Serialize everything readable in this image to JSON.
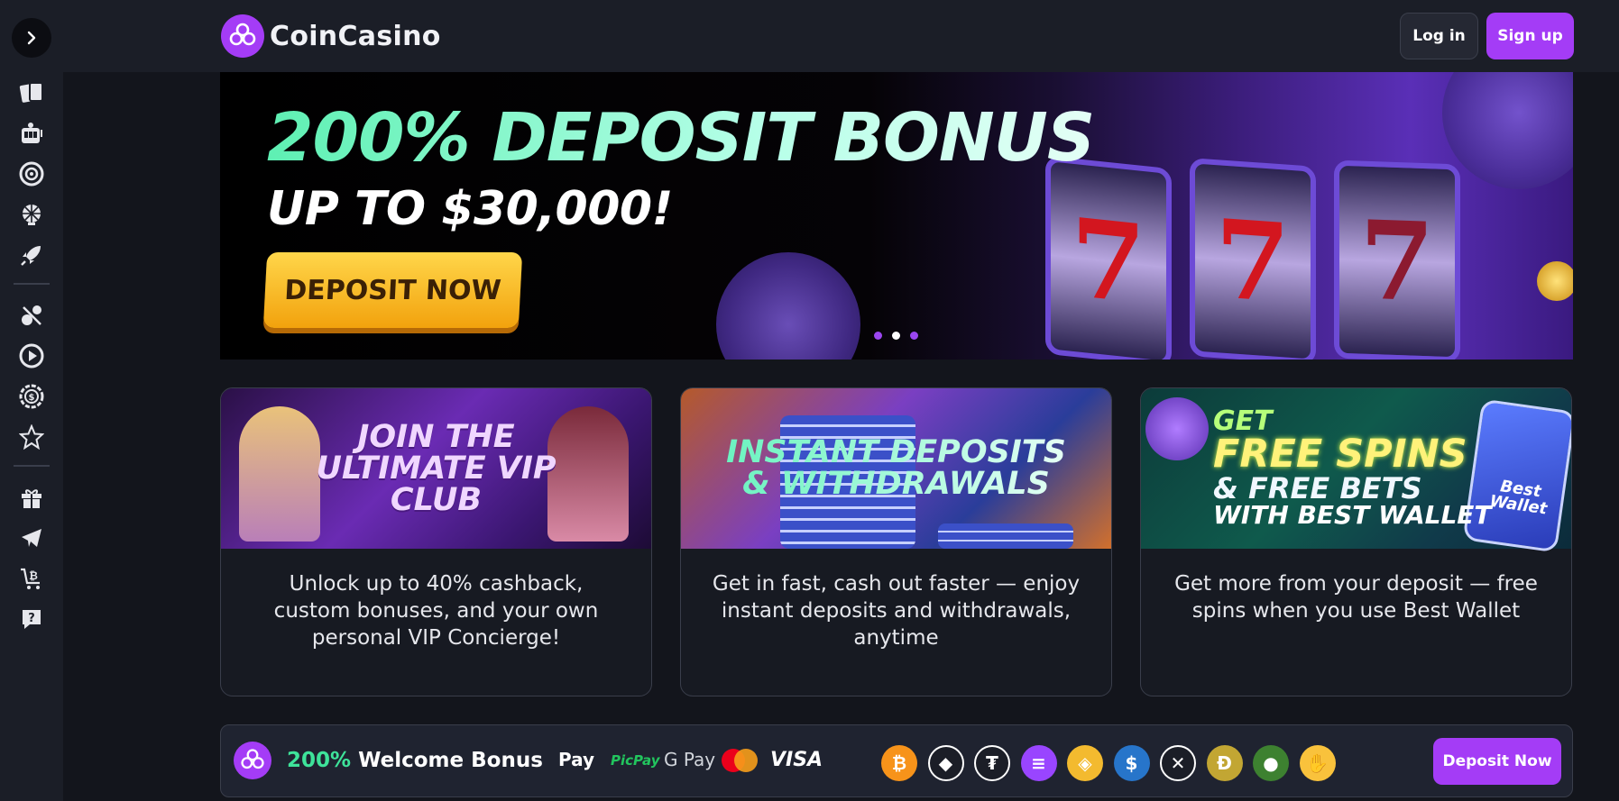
{
  "brand": {
    "name": "CoinCasino",
    "accent": "#a43cf6"
  },
  "header": {
    "login_label": "Log in",
    "signup_label": "Sign up"
  },
  "sidebar": {
    "toggle_icon": "chevron-right-icon",
    "group1": [
      "cards-icon",
      "slot-machine-icon",
      "roulette-icon",
      "wheel-icon",
      "rocket-icon"
    ],
    "group2": [
      "sports-icon",
      "play-icon",
      "dollar-chip-icon",
      "star-icon"
    ],
    "group3": [
      "gift-icon",
      "telegram-icon",
      "crypto-cart-icon",
      "support-chat-icon"
    ]
  },
  "hero": {
    "title": "200% DEPOSIT BONUS",
    "subtitle": "UP TO $30,000!",
    "cta_label": "DEPOSIT NOW",
    "slide_count": 3,
    "active_slide": 2,
    "reel_symbols": [
      "7",
      "7",
      "7"
    ]
  },
  "cards": [
    {
      "image_title": [
        "JOIN THE",
        "ULTIMATE VIP",
        "CLUB"
      ],
      "text": "Unlock up to 40% cashback, custom bonuses, and your own personal VIP Concierge!"
    },
    {
      "image_title": [
        "INSTANT DEPOSITS",
        "& WITHDRAWALS"
      ],
      "text": "Get in fast, cash out faster — enjoy instant deposits and withdrawals, anytime"
    },
    {
      "image_title": [
        "GET",
        "FREE SPINS",
        "& FREE BETS",
        "WITH BEST WALLET"
      ],
      "phone_label": "Best Wallet",
      "text": "Get more from your deposit — free spins when you use Best Wallet"
    }
  ],
  "bottom_bar": {
    "bonus_pct": "200%",
    "bonus_label": "Welcome Bonus",
    "payments": [
      "Pay",
      "PicPay",
      "G Pay",
      "mastercard",
      "VISA"
    ],
    "coins": [
      {
        "name": "bitcoin-icon",
        "glyph": "₿",
        "color": "#f7931a"
      },
      {
        "name": "ethereum-icon",
        "glyph": "◆",
        "color": "#ffffff"
      },
      {
        "name": "tether-icon",
        "glyph": "₮",
        "color": "#ffffff"
      },
      {
        "name": "solana-icon",
        "glyph": "≡",
        "color": "#9945ff"
      },
      {
        "name": "bnb-icon",
        "glyph": "◈",
        "color": "#f3ba2f"
      },
      {
        "name": "usdc-icon",
        "glyph": "$",
        "color": "#2775ca"
      },
      {
        "name": "xrp-icon",
        "glyph": "✕",
        "color": "#ffffff"
      },
      {
        "name": "dogecoin-icon",
        "glyph": "Ð",
        "color": "#c2a633"
      },
      {
        "name": "pepe-icon",
        "glyph": "●",
        "color": "#3d8130"
      },
      {
        "name": "bonk-icon",
        "glyph": "✋",
        "color": "#f9c23c"
      }
    ],
    "cta_label": "Deposit Now"
  }
}
